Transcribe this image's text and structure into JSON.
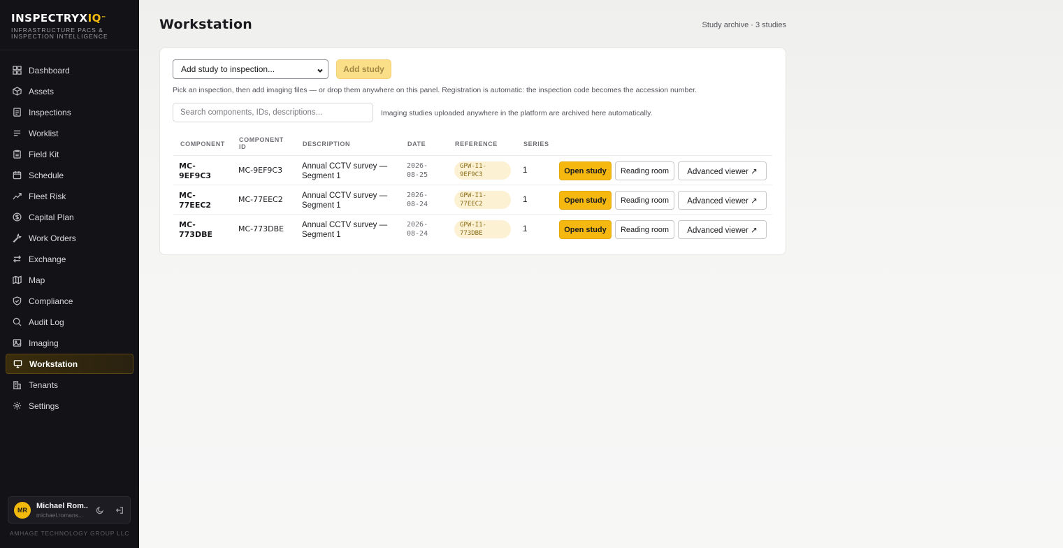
{
  "brand": {
    "name_main": "INSPECTRYX",
    "name_accent": "IQ",
    "tm": "™",
    "tagline_line1": "INFRASTRUCTURE PACS &",
    "tagline_line2": "INSPECTION INTELLIGENCE"
  },
  "sidebar": {
    "items": [
      {
        "label": "Dashboard",
        "icon": "dashboard-icon"
      },
      {
        "label": "Assets",
        "icon": "box-icon"
      },
      {
        "label": "Inspections",
        "icon": "document-icon"
      },
      {
        "label": "Worklist",
        "icon": "list-icon"
      },
      {
        "label": "Field Kit",
        "icon": "clipboard-icon"
      },
      {
        "label": "Schedule",
        "icon": "calendar-icon"
      },
      {
        "label": "Fleet Risk",
        "icon": "trend-icon"
      },
      {
        "label": "Capital Plan",
        "icon": "dollar-icon"
      },
      {
        "label": "Work Orders",
        "icon": "wrench-icon"
      },
      {
        "label": "Exchange",
        "icon": "swap-icon"
      },
      {
        "label": "Map",
        "icon": "map-icon"
      },
      {
        "label": "Compliance",
        "icon": "shield-icon"
      },
      {
        "label": "Audit Log",
        "icon": "search-icon"
      },
      {
        "label": "Imaging",
        "icon": "image-icon"
      },
      {
        "label": "Workstation",
        "icon": "monitor-icon",
        "active": true
      },
      {
        "label": "Tenants",
        "icon": "building-icon"
      },
      {
        "label": "Settings",
        "icon": "gear-icon"
      }
    ]
  },
  "user": {
    "initials": "MR",
    "name": "Michael Rom...",
    "email": "michael.romans..."
  },
  "company": "AMHAGE TECHNOLOGY GROUP LLC",
  "page": {
    "title": "Workstation",
    "archive_count": "Study archive · 3 studies"
  },
  "toolbar": {
    "select_value": "Add study to inspection...",
    "add_label": "Add study",
    "help_text": "Pick an inspection, then add imaging files — or drop them anywhere on this panel. Registration is automatic: the inspection code becomes the accession number.",
    "search_placeholder": "Search components, IDs, descriptions...",
    "search_note": "Imaging studies uploaded anywhere in the platform are archived here automatically."
  },
  "table": {
    "headers": {
      "component": "COMPONENT",
      "component_id_1": "COMPONENT",
      "component_id_2": "ID",
      "description": "DESCRIPTION",
      "date": "DATE",
      "reference": "REFERENCE",
      "series": "SERIES"
    },
    "rows": [
      {
        "comp1": "MC-",
        "comp2": "9EF9C3",
        "cid": "MC-9EF9C3",
        "desc1": "Annual CCTV survey —",
        "desc2": "Segment 1",
        "date1": "2026-",
        "date2": "08-25",
        "ref1": "GPW-I1-",
        "ref2": "9EF9C3",
        "series": "1"
      },
      {
        "comp1": "MC-",
        "comp2": "77EEC2",
        "cid": "MC-77EEC2",
        "desc1": "Annual CCTV survey —",
        "desc2": "Segment 1",
        "date1": "2026-",
        "date2": "08-24",
        "ref1": "GPW-I1-",
        "ref2": "77EEC2",
        "series": "1"
      },
      {
        "comp1": "MC-",
        "comp2": "773DBE",
        "cid": "MC-773DBE",
        "desc1": "Annual CCTV survey —",
        "desc2": "Segment 1",
        "date1": "2026-",
        "date2": "08-24",
        "ref1": "GPW-I1-",
        "ref2": "773DBE",
        "series": "1"
      }
    ],
    "actions": {
      "open": "Open study",
      "reading": "Reading room",
      "advanced": "Advanced viewer ↗"
    }
  },
  "colors": {
    "accent": "#f5b811",
    "sidebar_bg": "#131217"
  }
}
